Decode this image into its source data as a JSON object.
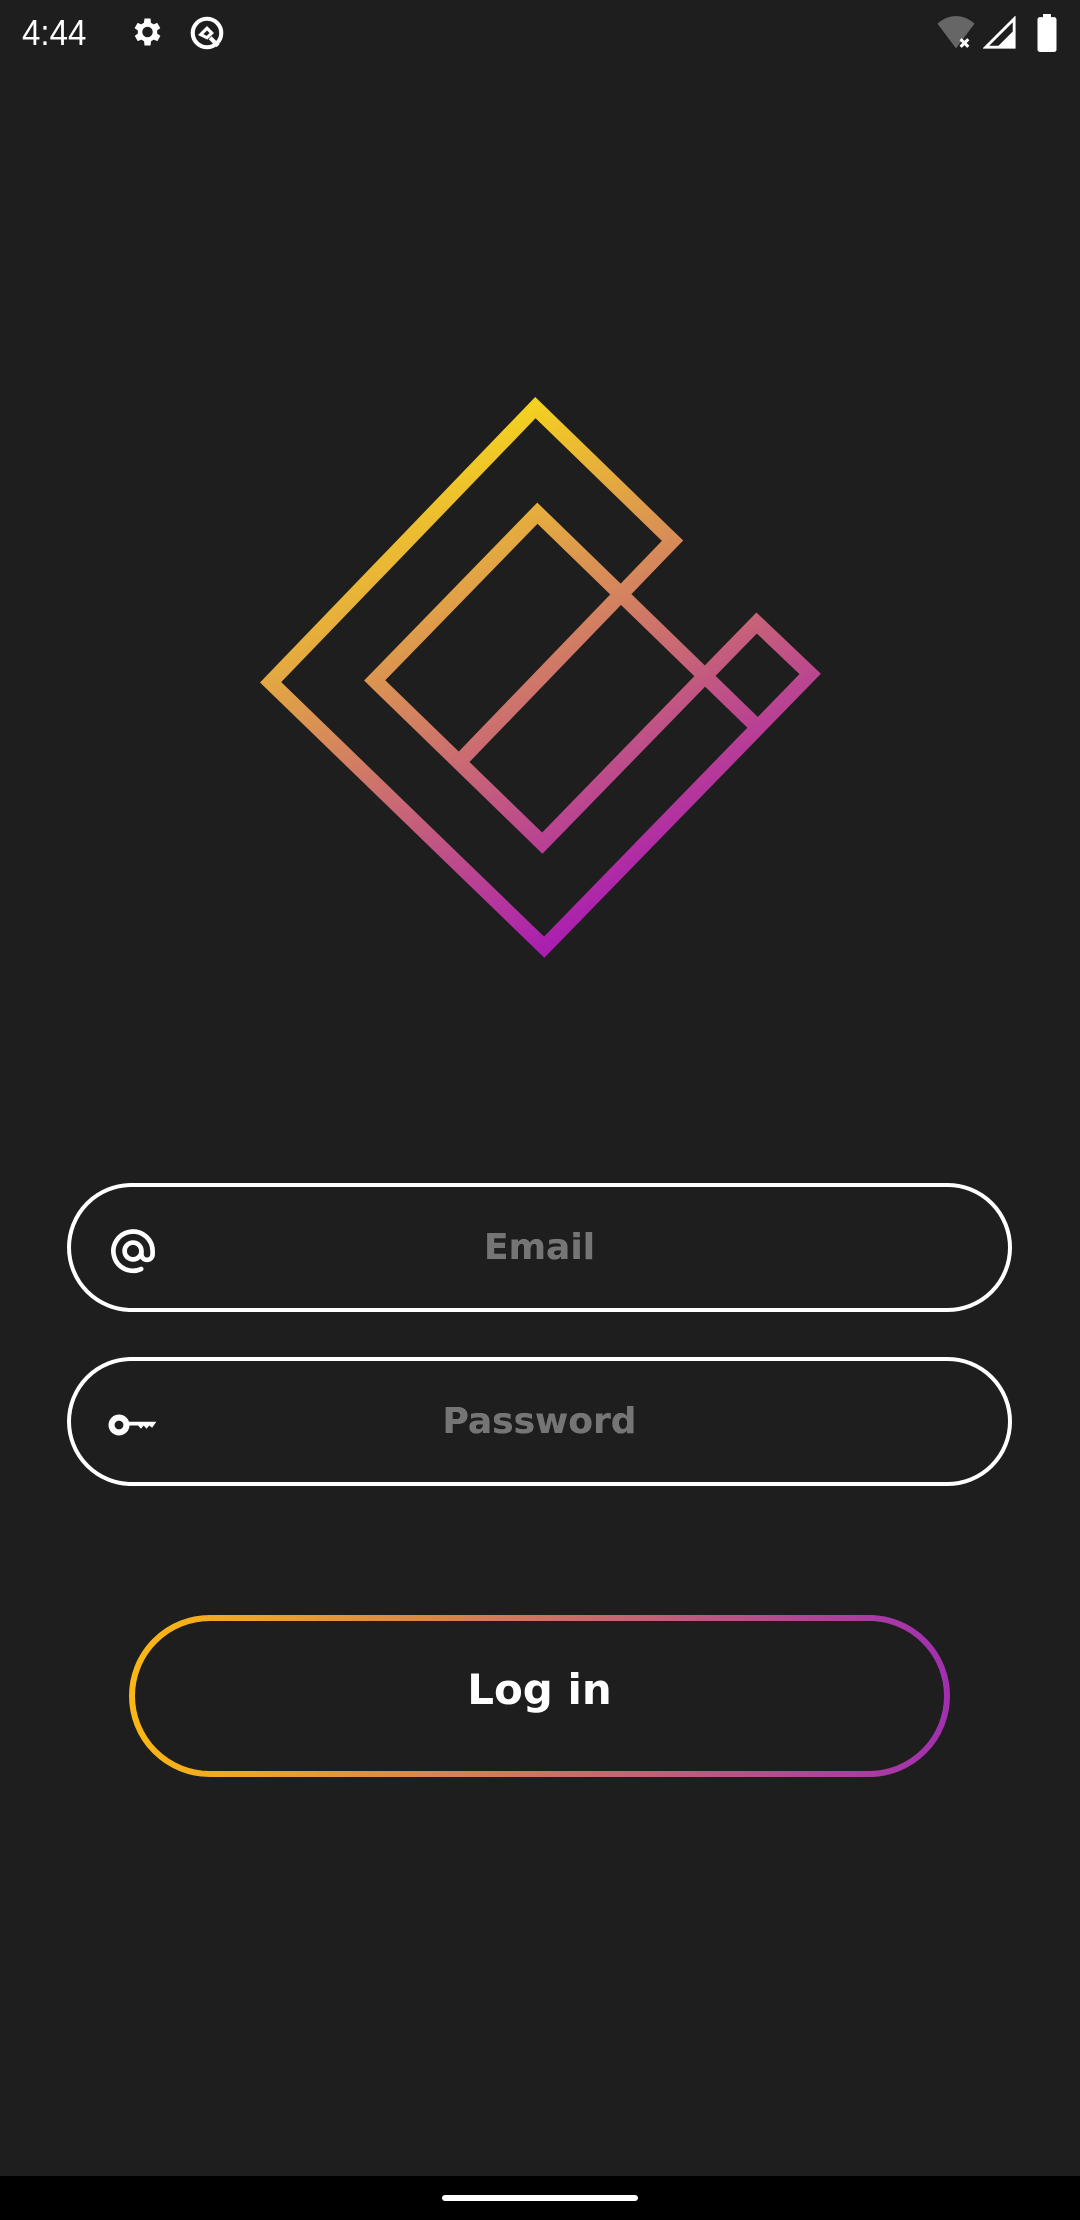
{
  "status_bar": {
    "time": "4:44",
    "icons": [
      "settings-icon",
      "app-notification-icon",
      "wifi-off-icon",
      "cell-signal-icon",
      "battery-icon"
    ]
  },
  "logo": {
    "gradient_start": "#f7d81a",
    "gradient_end": "#a614b8"
  },
  "form": {
    "email": {
      "placeholder": "Email",
      "value": "",
      "icon": "at-sign-icon"
    },
    "password": {
      "placeholder": "Password",
      "value": "",
      "icon": "key-icon"
    },
    "login_label": "Log in",
    "login_gradient_start": "#fbb812",
    "login_gradient_end": "#a22fb0"
  }
}
